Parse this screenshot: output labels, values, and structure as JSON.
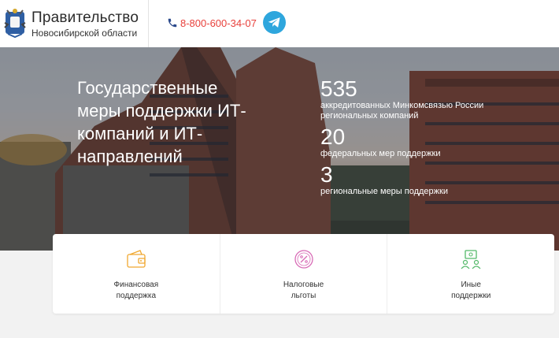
{
  "header": {
    "org_title": "Правительство",
    "org_subtitle": "Новосибирской области",
    "phone": "8-800-600-34-07"
  },
  "hero": {
    "title": "Государственные меры поддержки ИТ-компаний и ИТ-направлений",
    "stats": [
      {
        "number": "535",
        "label": "аккредитованных Минкомсвязью России\nрегиональных компаний"
      },
      {
        "number": "20",
        "label": "федеральных мер поддержки"
      },
      {
        "number": "3",
        "label": "региональные меры поддержки"
      }
    ]
  },
  "cards": [
    {
      "label": "Финансовая\nподдержка",
      "icon": "wallet-icon",
      "color": "#f0a830"
    },
    {
      "label": "Налоговые\nльготы",
      "icon": "percent-icon",
      "color": "#d86bb6"
    },
    {
      "label": "Иные\nподдержки",
      "icon": "people-icon",
      "color": "#55b96a"
    }
  ],
  "colors": {
    "phone": "#e8413c",
    "telegram": "#2ea6dd"
  }
}
